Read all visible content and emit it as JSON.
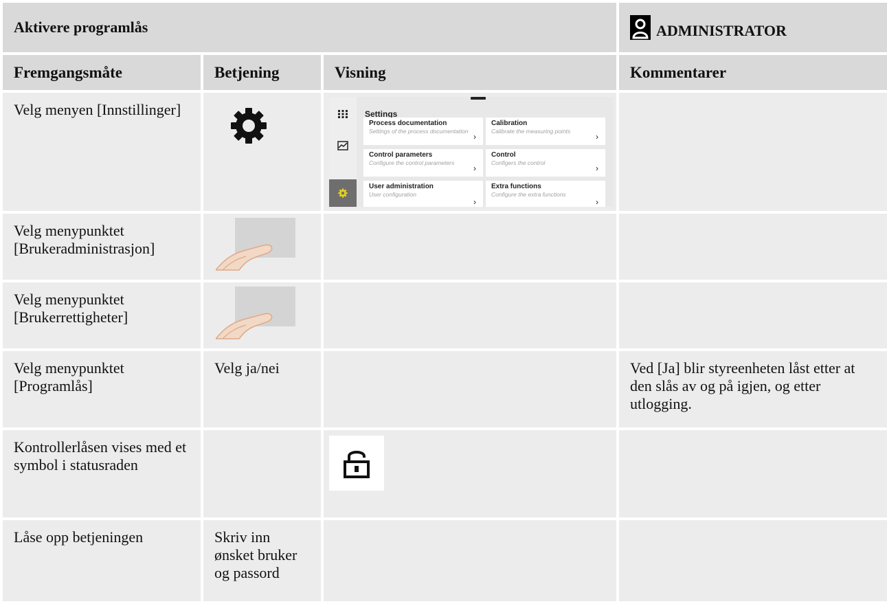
{
  "header": {
    "title": "Aktivere programlås",
    "role": "ADMINISTRATOR"
  },
  "columns": [
    "Fremgangsmåte",
    "Betjening",
    "Visning",
    "Kommentarer"
  ],
  "rows": [
    {
      "step": "Velg menyen [Innstillinger]",
      "operation": "",
      "display_icon": "settings-screen",
      "operation_icon": "gear-icon",
      "comment": ""
    },
    {
      "step": "Velg menypunktet [Brukeradministrasjon]",
      "operation": "",
      "operation_icon": "finger-tap-icon",
      "comment": ""
    },
    {
      "step": "Velg menypunktet [Brukerrettigheter]",
      "operation": "",
      "operation_icon": "finger-tap-icon",
      "comment": ""
    },
    {
      "step": "Velg menypunktet [Programlås]",
      "operation": "Velg ja/nei",
      "comment": "Ved [Ja] blir styreenheten låst etter at den slås av og på igjen, og etter utlogging."
    },
    {
      "step": "Kontrollerlåsen vises med et symbol i statusraden",
      "operation": "",
      "display_icon": "lock-icon",
      "comment": ""
    },
    {
      "step": "Låse opp betjeningen",
      "operation": "Skriv inn ønsket bruker og passord",
      "comment": ""
    }
  ],
  "settings_screen": {
    "title": "Settings",
    "cards": [
      {
        "title": "Process documentation",
        "subtitle": "Settings of the process documentation"
      },
      {
        "title": "Calibration",
        "subtitle": "Calibrate the measuring points"
      },
      {
        "title": "Control parameters",
        "subtitle": "Configure the control parameters"
      },
      {
        "title": "Control",
        "subtitle": "Configers the control"
      },
      {
        "title": "User administration",
        "subtitle": "User configuration"
      },
      {
        "title": "Extra functions",
        "subtitle": "Configure the extra functions"
      }
    ],
    "arrow": "›",
    "colors": {
      "active_nav": "#6e6e6e",
      "gear_active": "#e8d31a"
    }
  }
}
